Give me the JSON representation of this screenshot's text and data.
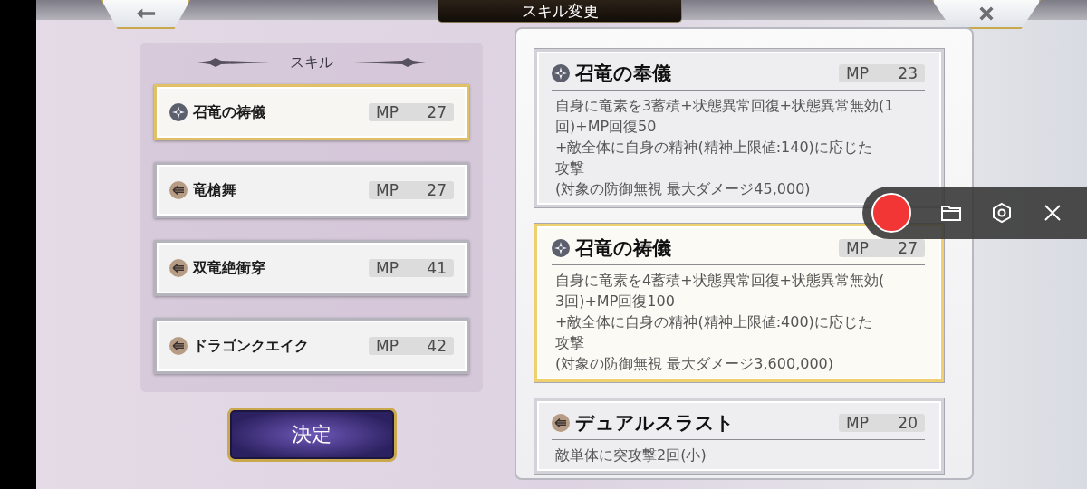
{
  "top_bar": {
    "title": "スキル変更"
  },
  "skill_panel": {
    "heading": "スキル",
    "skills": [
      {
        "kind": "sparkle",
        "name": "召竜の祷儀",
        "mp_label": "MP",
        "mp": "27",
        "selected": true
      },
      {
        "kind": "arrow",
        "name": "竜槍舞",
        "mp_label": "MP",
        "mp": "27",
        "selected": false
      },
      {
        "kind": "arrow",
        "name": "双竜絶衝穿",
        "mp_label": "MP",
        "mp": "41",
        "selected": false
      },
      {
        "kind": "arrow",
        "name": "ドラゴンクエイク",
        "mp_label": "MP",
        "mp": "42",
        "selected": false
      }
    ]
  },
  "confirm_button": "決定",
  "detail_cards": [
    {
      "kind": "sparkle",
      "name": "召竜の奉儀",
      "mp_label": "MP",
      "mp": "23",
      "selected": false,
      "description": [
        "自身に竜素を3蓄積+状態異常回復+状態異常無効(1",
        "回)+MP回復50",
        "+敵全体に自身の精神(精神上限値:140)に応じた",
        "攻撃",
        "(対象の防御無視 最大ダメージ45,000)"
      ]
    },
    {
      "kind": "sparkle",
      "name": "召竜の祷儀",
      "mp_label": "MP",
      "mp": "27",
      "selected": true,
      "description": [
        "自身に竜素を4蓄積+状態異常回復+状態異常無効(",
        "3回)+MP回復100",
        "+敵全体に自身の精神(精神上限値:400)に応じた",
        "攻撃",
        "(対象の防御無視 最大ダメージ3,600,000)"
      ]
    },
    {
      "kind": "arrow",
      "name": "デュアルスラスト",
      "mp_label": "MP",
      "mp": "20",
      "selected": false,
      "description": [
        "敵単体に突攻撃2回(小)"
      ]
    }
  ]
}
